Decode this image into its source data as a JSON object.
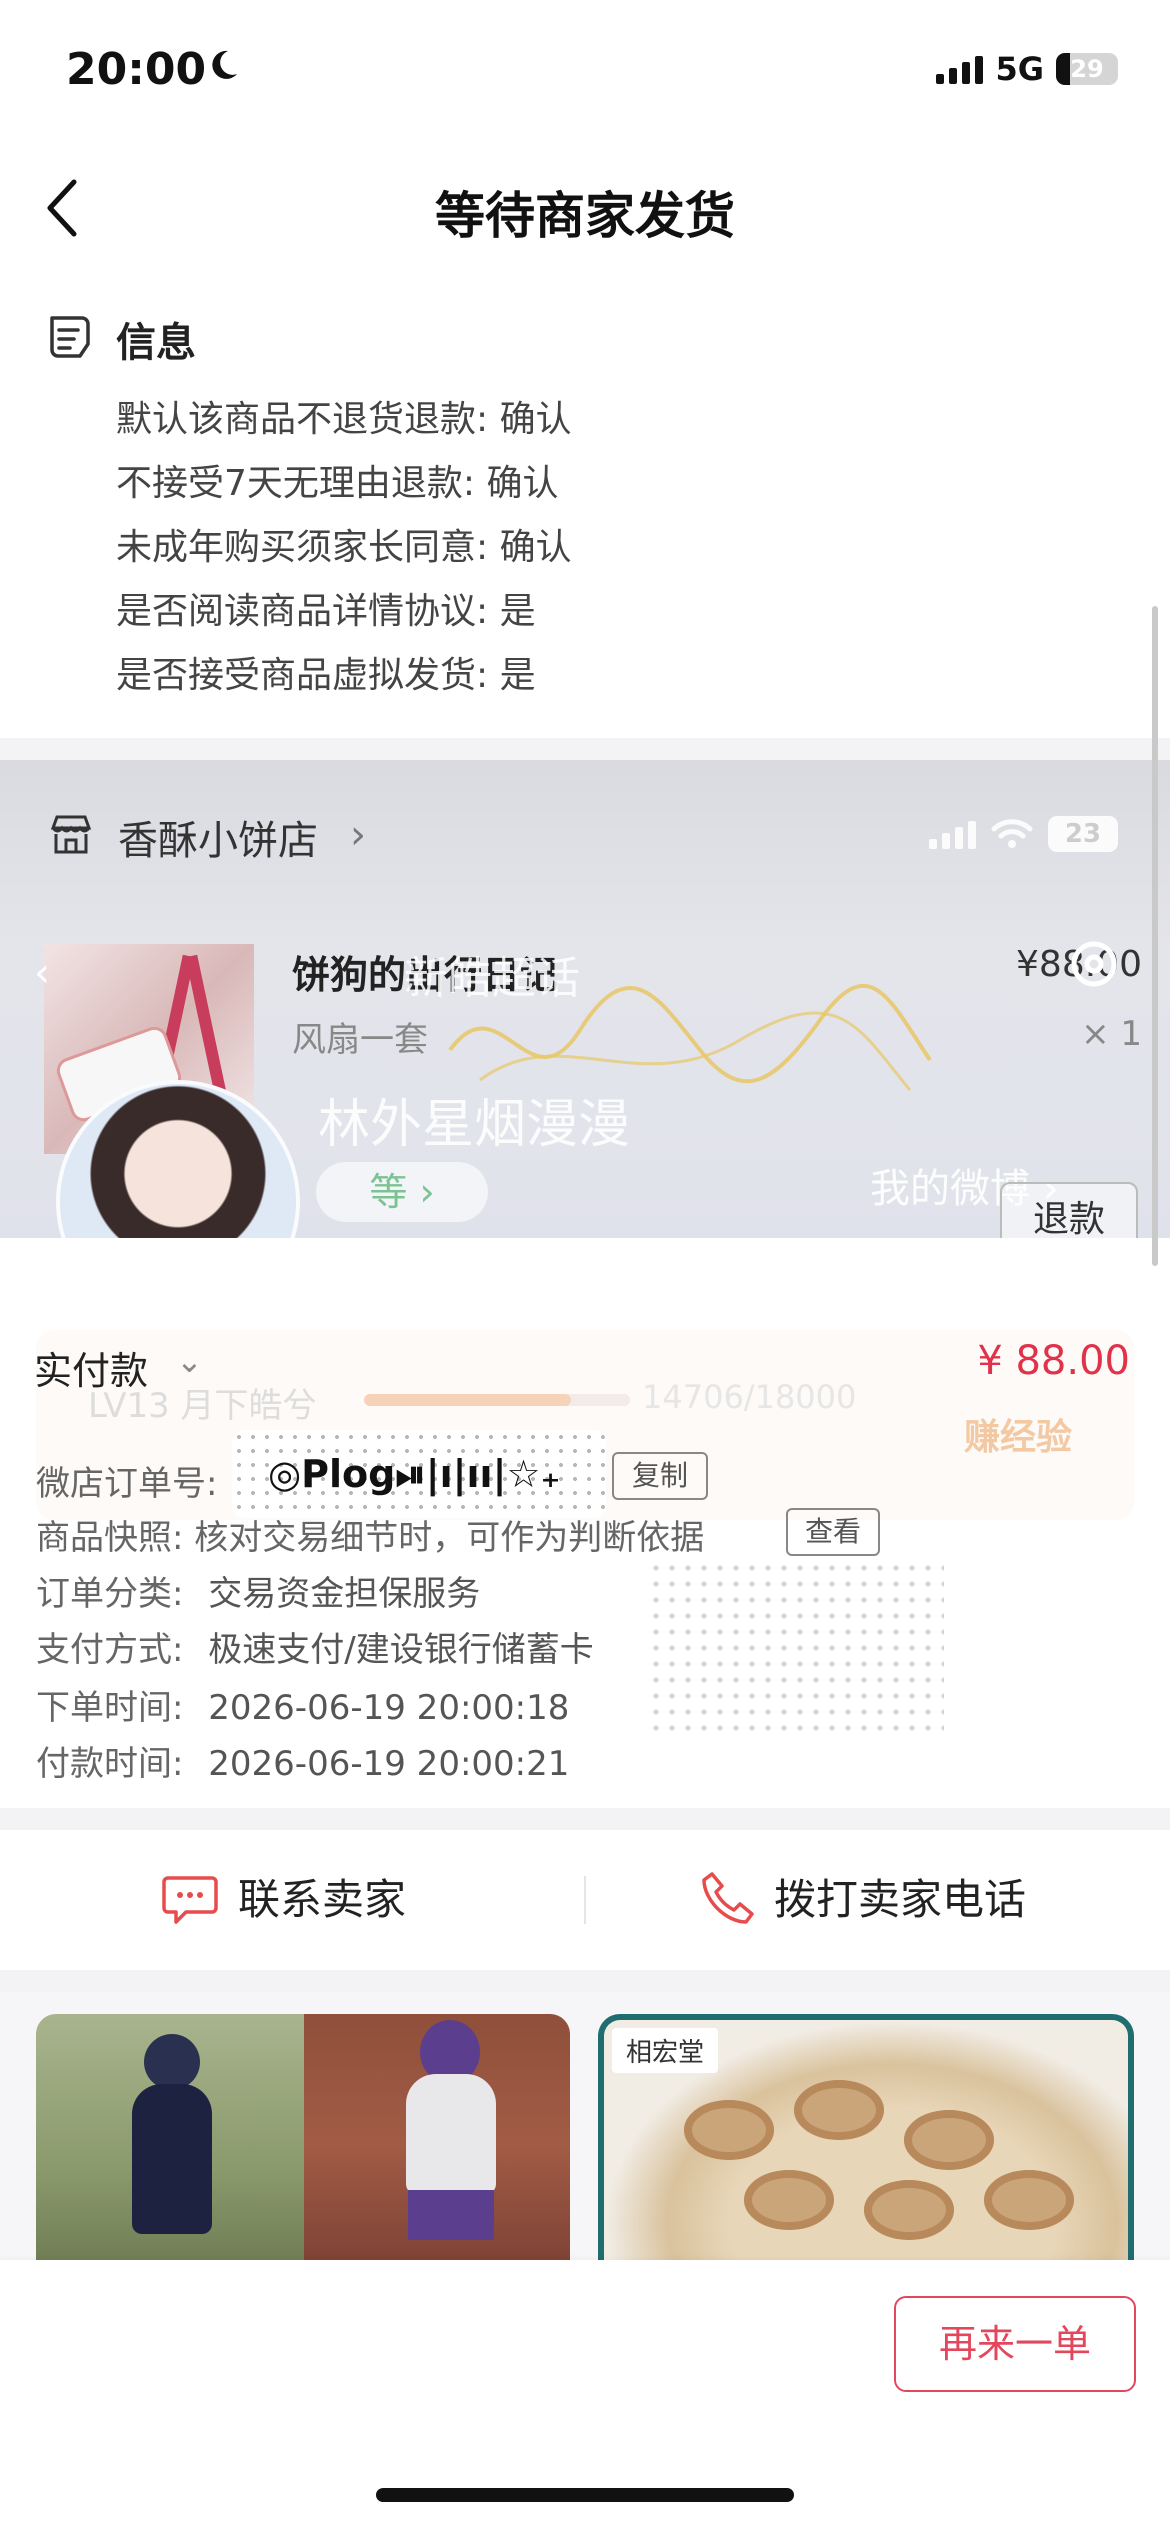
{
  "status_bar": {
    "time": "20:00",
    "network": "5G",
    "battery": "29"
  },
  "header": {
    "title": "等待商家发货"
  },
  "info": {
    "title": "信息",
    "lines": [
      "默认该商品不退货退款: 确认",
      "不接受7天无理由退款: 确认",
      "未成年购买须家长同意: 确认",
      "是否阅读商品详情协议: 是",
      "是否接受商品虚拟发货: 是"
    ]
  },
  "shop": {
    "name": "香酥小饼店",
    "chevron": "›"
  },
  "product": {
    "name": "饼狗的出行日记",
    "variant": "风扇一套",
    "price": "¥88.00",
    "quantity": "× 1",
    "refund_label": "退款"
  },
  "overlay_ghost": {
    "status_battery": "23",
    "title": "新皓超话",
    "name": "林外星烟漫漫",
    "pill": "等 ›",
    "weibo": "我的微博 ›",
    "badge": "V",
    "level_text": "LV13 月下皓兮",
    "exp_text": "14706/18000",
    "earn_text": "赚经验"
  },
  "order": {
    "pay_label": "实付款",
    "pay_amount": "¥ 88.00",
    "order_no_label": "微店订单号:",
    "plog_text": "◎Plog⏯|ı|ıı|☆₊",
    "copy_label": "复制",
    "snapshot_label": "商品快照: 核对交易细节时，可作为判断依据",
    "view_label": "查看",
    "category_label": "订单分类:",
    "category_value": "交易资金担保服务",
    "payment_label": "支付方式:",
    "payment_value": "极速支付/建设银行储蓄卡",
    "order_time_label": "下单时间:",
    "order_time_value": "2026-06-19 20:00:18",
    "pay_time_label": "付款时间:",
    "pay_time_value": "2026-06-19 20:00:21"
  },
  "contact": {
    "seller": "联系卖家",
    "call": "拨打卖家电话"
  },
  "recommend": {
    "brand_label": "相宏堂"
  },
  "footer": {
    "reorder": "再来一单"
  },
  "colors": {
    "accent": "#e3475e",
    "price": "#e0324a",
    "teal": "#1f6d6f"
  },
  "icons": [
    "moon-icon",
    "signal-icon",
    "battery-icon",
    "back-chevron-icon",
    "info-list-icon",
    "shop-icon",
    "chat-icon",
    "phone-icon",
    "gear-icon"
  ]
}
